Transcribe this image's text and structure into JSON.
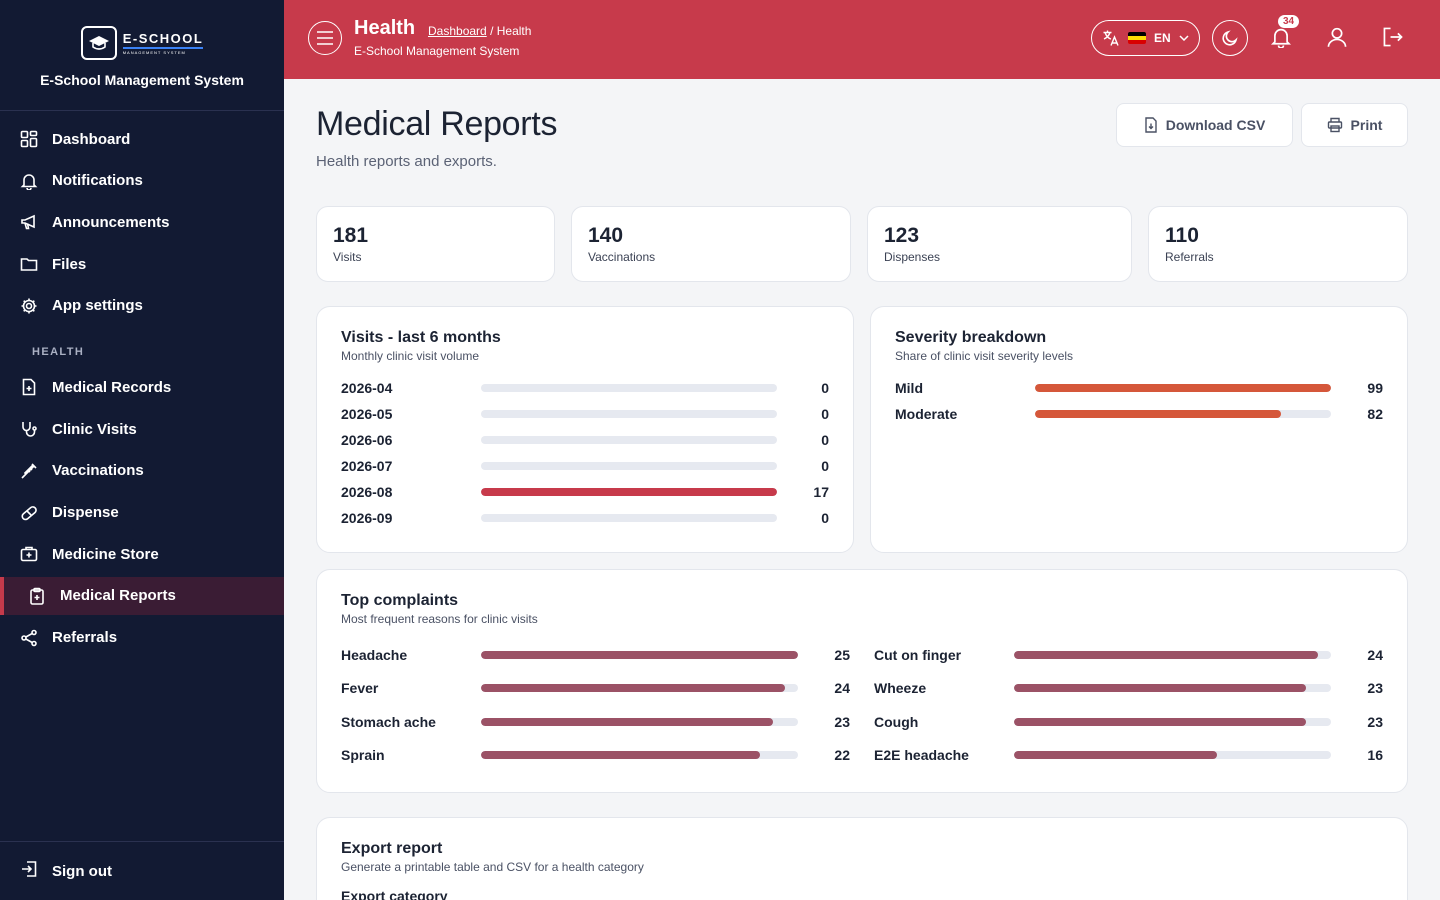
{
  "app": {
    "logo_big": "E-SCHOOL",
    "logo_small": "MANAGEMENT SYSTEM",
    "name": "E-School Management System"
  },
  "sidebar": {
    "items": [
      {
        "label": "Dashboard",
        "icon": "grid-icon"
      },
      {
        "label": "Notifications",
        "icon": "bell-icon"
      },
      {
        "label": "Announcements",
        "icon": "megaphone-icon"
      },
      {
        "label": "Files",
        "icon": "folder-icon"
      },
      {
        "label": "App settings",
        "icon": "gear-icon"
      }
    ],
    "section": "HEALTH",
    "health_items": [
      {
        "label": "Medical Records",
        "icon": "file-medical-icon"
      },
      {
        "label": "Clinic Visits",
        "icon": "stethoscope-icon"
      },
      {
        "label": "Vaccinations",
        "icon": "syringe-icon"
      },
      {
        "label": "Dispense",
        "icon": "pill-icon"
      },
      {
        "label": "Medicine Store",
        "icon": "medkit-icon"
      },
      {
        "label": "Medical Reports",
        "icon": "clipboard-icon",
        "active": true
      },
      {
        "label": "Referrals",
        "icon": "share-icon"
      }
    ],
    "signout": "Sign out"
  },
  "header": {
    "title": "Health",
    "breadcrumb_link": "Dashboard",
    "breadcrumb_current": "/ Health",
    "subtitle": "E-School Management System",
    "language": "EN",
    "notification_count": "34"
  },
  "page": {
    "title": "Medical Reports",
    "subtitle": "Health reports and exports.",
    "download_csv": "Download CSV",
    "print": "Print"
  },
  "stats": [
    {
      "value": "181",
      "label": "Visits"
    },
    {
      "value": "140",
      "label": "Vaccinations"
    },
    {
      "value": "123",
      "label": "Dispenses"
    },
    {
      "value": "110",
      "label": "Referrals"
    }
  ],
  "visits": {
    "title": "Visits - last 6 months",
    "subtitle": "Monthly clinic visit volume",
    "color": "#c73a4b",
    "rows": [
      {
        "label": "2026-04",
        "value": 0,
        "fraction": 0
      },
      {
        "label": "2026-05",
        "value": 0,
        "fraction": 0
      },
      {
        "label": "2026-06",
        "value": 0,
        "fraction": 0
      },
      {
        "label": "2026-07",
        "value": 0,
        "fraction": 0
      },
      {
        "label": "2026-08",
        "value": 17,
        "fraction": 1
      },
      {
        "label": "2026-09",
        "value": 0,
        "fraction": 0
      }
    ]
  },
  "severity": {
    "title": "Severity breakdown",
    "subtitle": "Share of clinic visit severity levels",
    "color": "#d5573a",
    "rows": [
      {
        "label": "Mild",
        "value": 99,
        "fraction": 1
      },
      {
        "label": "Moderate",
        "value": 82,
        "fraction": 0.83
      }
    ]
  },
  "complaints": {
    "title": "Top complaints",
    "subtitle": "Most frequent reasons for clinic visits",
    "color": "#9b5266",
    "rows": [
      {
        "label": "Headache",
        "value": 25,
        "fraction": 1
      },
      {
        "label": "Cut on finger",
        "value": 24,
        "fraction": 0.96
      },
      {
        "label": "Fever",
        "value": 24,
        "fraction": 0.96
      },
      {
        "label": "Wheeze",
        "value": 23,
        "fraction": 0.92
      },
      {
        "label": "Stomach ache",
        "value": 23,
        "fraction": 0.92
      },
      {
        "label": "Cough",
        "value": 23,
        "fraction": 0.92
      },
      {
        "label": "Sprain",
        "value": 22,
        "fraction": 0.88
      },
      {
        "label": "E2E headache",
        "value": 16,
        "fraction": 0.64
      }
    ]
  },
  "export": {
    "title": "Export report",
    "subtitle": "Generate a printable table and CSV for a health category",
    "field_label": "Export category"
  }
}
